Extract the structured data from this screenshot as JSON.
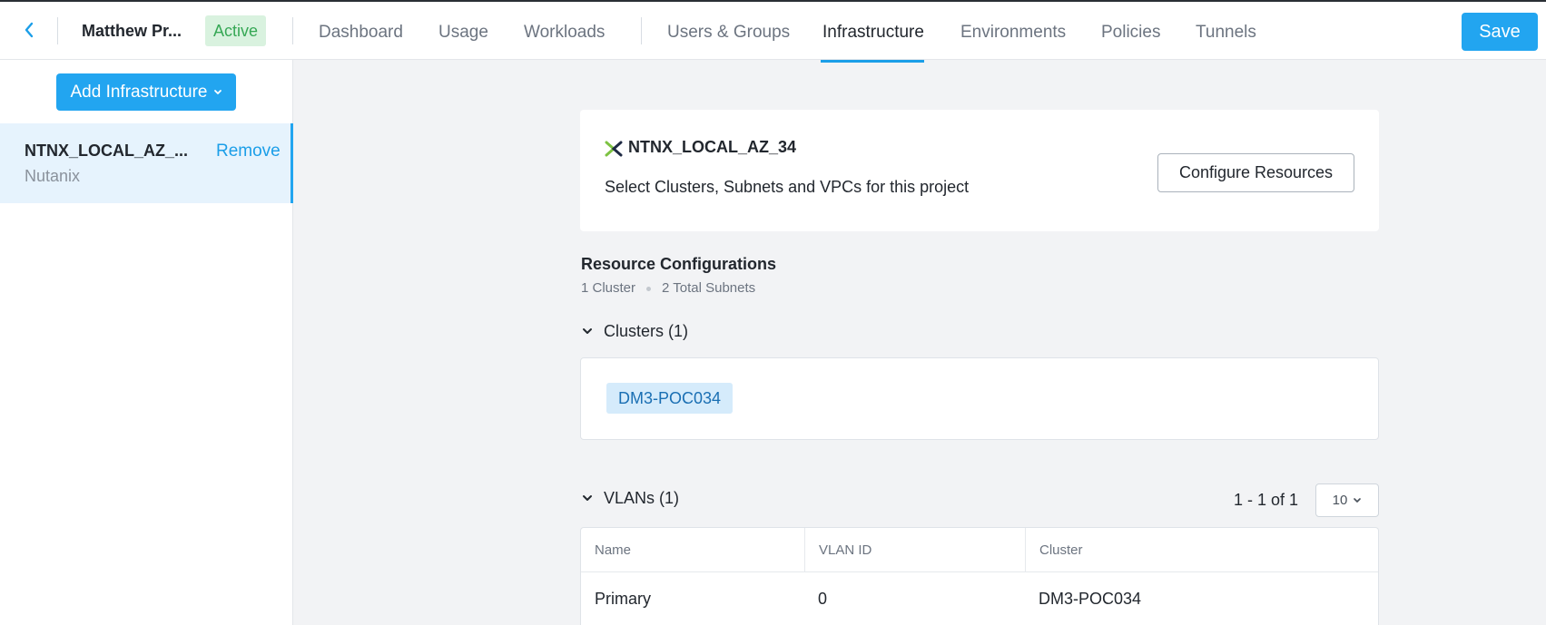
{
  "header": {
    "project_name": "Matthew Pr...",
    "status": "Active",
    "tabs": [
      {
        "label": "Dashboard"
      },
      {
        "label": "Usage"
      },
      {
        "label": "Workloads"
      },
      {
        "label": "Users & Groups"
      },
      {
        "label": "Infrastructure",
        "active": true
      },
      {
        "label": "Environments"
      },
      {
        "label": "Policies"
      },
      {
        "label": "Tunnels"
      }
    ],
    "save_label": "Save"
  },
  "sidebar": {
    "add_button_label": "Add Infrastructure",
    "items": [
      {
        "name": "NTNX_LOCAL_AZ_...",
        "type": "Nutanix",
        "remove_label": "Remove"
      }
    ]
  },
  "provider": {
    "name": "NTNX_LOCAL_AZ_34",
    "description": "Select Clusters, Subnets and VPCs for this project",
    "configure_label": "Configure Resources"
  },
  "resources": {
    "title": "Resource Configurations",
    "cluster_count": "1 Cluster",
    "subnet_count": "2 Total Subnets",
    "clusters": {
      "label": "Clusters (1)",
      "items": [
        "DM3-POC034"
      ]
    },
    "vlans": {
      "label": "VLANs (1)",
      "pager": "1 - 1 of 1",
      "page_size": "10",
      "columns": [
        "Name",
        "VLAN ID",
        "Cluster"
      ],
      "rows": [
        [
          "Primary",
          "0",
          "DM3-POC034"
        ]
      ]
    }
  },
  "colors": {
    "accent": "#22a5f0",
    "active_badge_bg": "#d9f2df",
    "active_badge_text": "#36a855",
    "selected_item_bg": "#e6f3fd",
    "tag_bg": "#d5ebfb"
  },
  "icons": {
    "back": "chevron-left-icon",
    "dropdown": "chevron-down-icon",
    "provider_logo": "nutanix-logo-icon"
  }
}
